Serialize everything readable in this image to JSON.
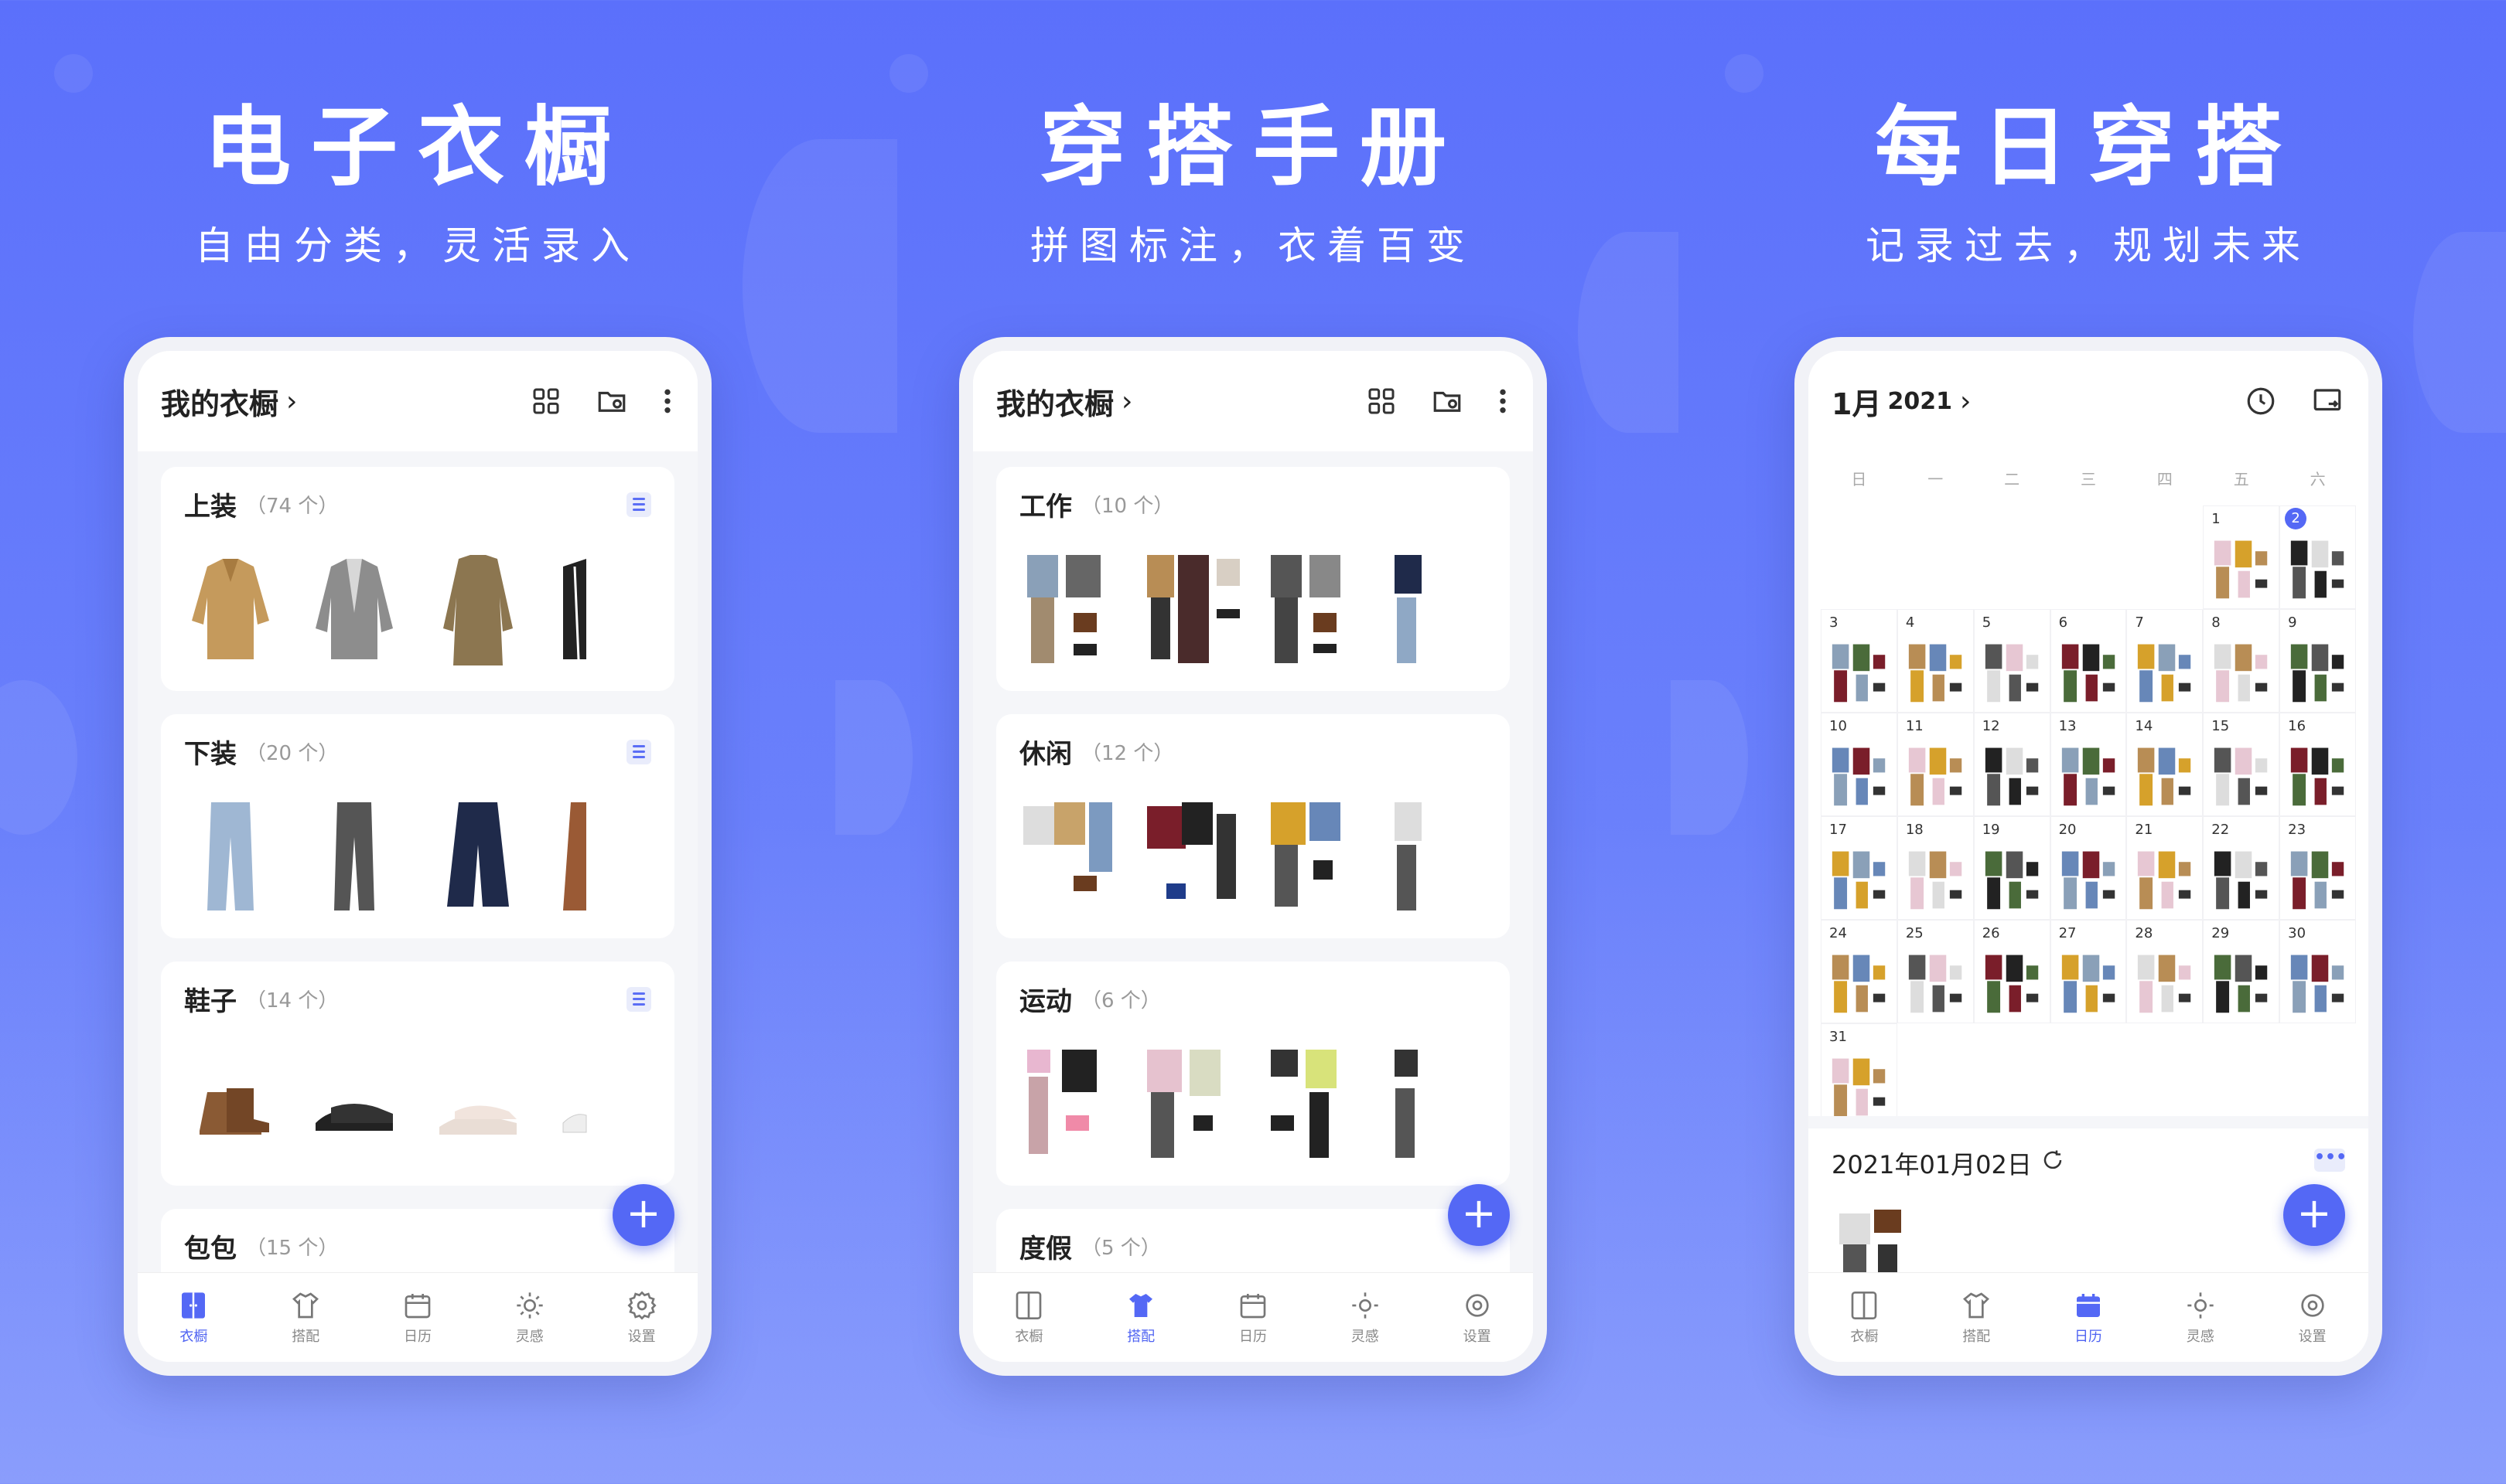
{
  "panels": [
    {
      "title": "电子衣橱",
      "subtitle": "自由分类，灵活录入",
      "header": {
        "title": "我的衣橱",
        "chevron": "›"
      },
      "cards": [
        {
          "name": "上装",
          "count": "（74 个）"
        },
        {
          "name": "下装",
          "count": "（20 个）"
        },
        {
          "name": "鞋子",
          "count": "（14 个）"
        },
        {
          "name": "包包",
          "count": "（15 个）"
        }
      ],
      "active_tab": 0
    },
    {
      "title": "穿搭手册",
      "subtitle": "拼图标注，衣着百变",
      "header": {
        "title": "我的衣橱",
        "chevron": "›"
      },
      "cards": [
        {
          "name": "工作",
          "count": "（10 个）"
        },
        {
          "name": "休闲",
          "count": "（12 个）"
        },
        {
          "name": "运动",
          "count": "（6 个）"
        },
        {
          "name": "度假",
          "count": "（5 个）"
        }
      ],
      "active_tab": 1
    },
    {
      "title": "每日穿搭",
      "subtitle": "记录过去，规划未来",
      "header": {
        "title": "1月",
        "year": "2021",
        "chevron": "›"
      },
      "weekdays": [
        "日",
        "一",
        "二",
        "三",
        "四",
        "五",
        "六"
      ],
      "days": [
        "1",
        "2",
        "3",
        "4",
        "5",
        "6",
        "7",
        "8",
        "9",
        "10",
        "11",
        "12",
        "13",
        "14",
        "15",
        "16",
        "17",
        "18",
        "19",
        "20",
        "21",
        "22",
        "23",
        "24",
        "25",
        "26",
        "27",
        "28",
        "29",
        "30",
        "31"
      ],
      "today": "2",
      "selected_date": "2021年01月02日",
      "more_label": "•••",
      "active_tab": 2
    }
  ],
  "tabs": [
    "衣橱",
    "搭配",
    "日历",
    "灵感",
    "设置"
  ],
  "fab_label": "+",
  "colors": {
    "accent": "#5468f5",
    "background_top": "#5b70fb",
    "background_bottom": "#8a9dfc"
  },
  "icons": {
    "grid": "grid-icon",
    "folder_settings": "folder-settings-icon",
    "more": "more-vertical-icon",
    "clock": "clock-icon",
    "swap": "swap-icon",
    "refresh": "refresh-icon",
    "tab_icons": [
      "wardrobe-icon",
      "outfit-icon",
      "calendar-icon",
      "inspiration-icon",
      "settings-icon"
    ]
  }
}
